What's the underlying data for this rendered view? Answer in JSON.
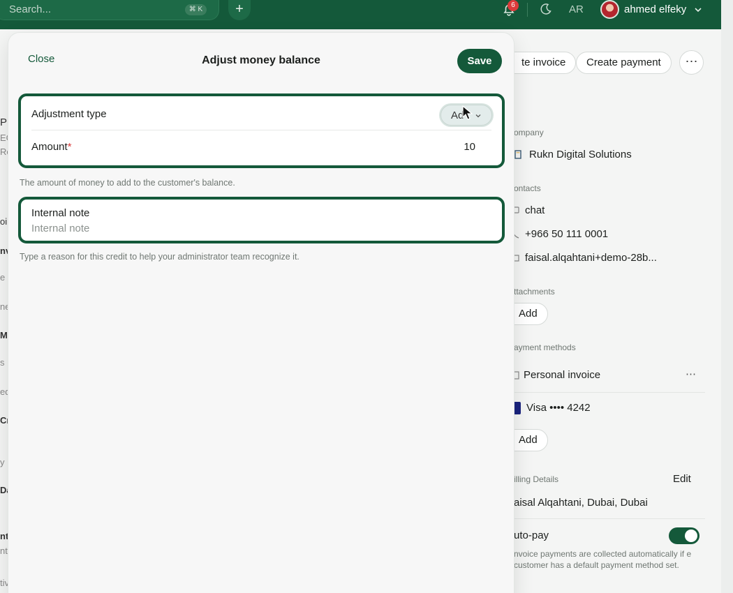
{
  "topbar": {
    "search_placeholder": "Search...",
    "search_shortcut": "⌘ K",
    "add_symbol": "+",
    "notification_count": "6",
    "language": "AR",
    "user_name": "ahmed elfeky",
    "accent_color": "#14593a"
  },
  "background": {
    "create_invoice_label": "te invoice",
    "create_payment_label": "Create payment",
    "more_symbol": "⋯",
    "company_label": "ompany",
    "company_name": "Rukn Digital Solutions",
    "contacts_label": "ontacts",
    "contact_chat": "chat",
    "contact_phone": "+966 50 111 0001",
    "contact_email": "faisal.alqahtani+demo-28b...",
    "attachments_label": "ttachments",
    "attachments_add": "Add",
    "payment_methods_label": "ayment methods",
    "payment_method_1": "Personal invoice",
    "payment_method_2": "Visa •••• 4242",
    "payment_methods_add": "Add",
    "billing_label": "illing Details",
    "billing_edit": "Edit",
    "billing_value": "aisal Alqahtani, Dubai, Dubai",
    "autopay_label": "uto-pay",
    "autopay_desc": "nvoice payments are collected automatically if e customer has a default payment method set.",
    "left_fragments": [
      "Pr",
      "EG",
      "Re",
      "oi",
      "nv",
      "e s",
      "ne",
      "Mo",
      "s b",
      "ed",
      "Cr",
      "y |",
      "Da",
      "nt",
      "nt",
      "tiv"
    ]
  },
  "modal": {
    "close_label": "Close",
    "title": "Adjust money balance",
    "save_label": "Save",
    "adjustment_type_label": "Adjustment type",
    "adjustment_type_value": "Ad",
    "amount_label": "Amount",
    "amount_required_mark": "*",
    "amount_value": "10",
    "amount_help": "The amount of money to add to the customer's balance.",
    "internal_note_label": "Internal note",
    "internal_note_placeholder": "Internal note",
    "internal_note_help": "Type a reason for this credit to help your administrator team recognize it."
  }
}
